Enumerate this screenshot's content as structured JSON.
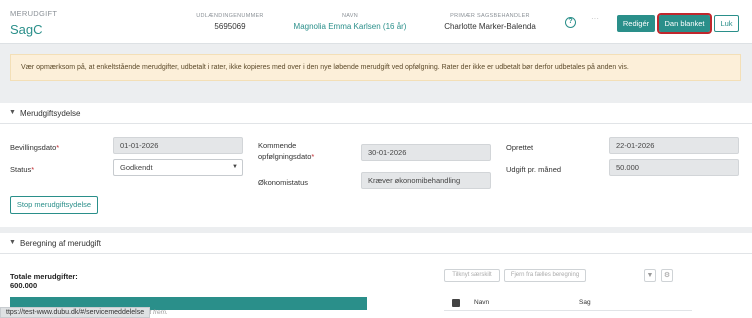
{
  "header": {
    "app_label": "MERUDGIFT",
    "title": "SagC",
    "fields": [
      {
        "label": "UDLÆNDINGENUMMER",
        "value": "5695069"
      },
      {
        "label": "NAVN",
        "value": "Magnolia Emma Karlsen (16 år)"
      },
      {
        "label": "PRIMÆR SAGSBEHANDLER",
        "value": "Charlotte Marker-Balenda"
      }
    ],
    "help_glyph": "?",
    "more_glyph": "···",
    "buttons": {
      "edit": "Redigér",
      "form": "Dan blanket",
      "close": "Luk"
    }
  },
  "alert": {
    "text": "Vær opmærksom på, at enkeltstående merudgifter, udbetalt i rater, ikke kopieres med over i den nye løbende merudgift ved opfølgning. Rater der ikke er udbetalt bør derfor udbetales på anden vis."
  },
  "benefit": {
    "title": "Merudgiftsydelse",
    "grant_date": {
      "label": "Bevillingsdato",
      "value": "01-01-2026"
    },
    "status": {
      "label": "Status",
      "value": "Godkendt"
    },
    "next_followup": {
      "label_line1": "Kommende",
      "label_line2": "opfølgningsdato",
      "value": "30-01-2026"
    },
    "economy_status": {
      "label": "Økonomistatus",
      "value": "Kræver økonomibehandling"
    },
    "created": {
      "label": "Oprettet",
      "value": "22-01-2026"
    },
    "monthly_payout": {
      "label": "Udgift pr. måned",
      "value": "50.000"
    },
    "stop_button": "Stop merudgiftsydelse",
    "required_mark": "*"
  },
  "calculation": {
    "title": "Beregning af merudgift",
    "total_label": "Totale merudgifter:",
    "total_value": "600.000",
    "progress_fraction": 1.0,
    "btn_collapse_all": "Tilknyt særskilt",
    "btn_remove_common": "Fjern fra fælles beregning",
    "table_headers": {
      "name": "Navn",
      "case": "Sag"
    },
    "icon_a": "filter-icon",
    "icon_b": "settings-icon"
  },
  "statusbar": {
    "url": "ttps://test-www.dubu.dk/#/servicemeddelelse",
    "behind_text": "it frem."
  },
  "colors": {
    "accent": "#2a8f8a",
    "highlight": "#c0272d",
    "alert_bg": "#fcefd9"
  }
}
